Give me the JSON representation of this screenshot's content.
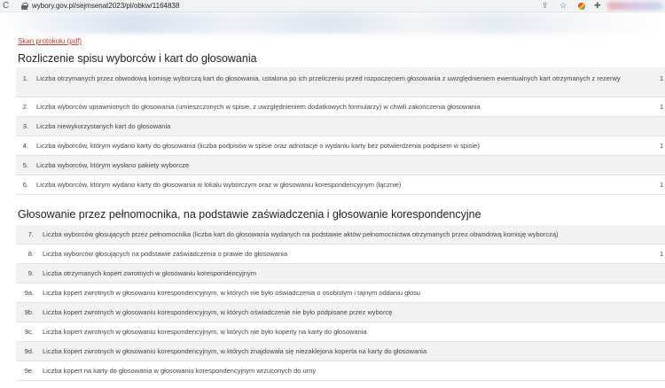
{
  "browser": {
    "reload_icon": "reload-icon",
    "lock_icon": "lock-icon",
    "url": "wybory.gov.pl/sejmsenat2023/pl/obkw/1164838"
  },
  "links": {
    "protocol_scan": "Skan protokołu (pdf)"
  },
  "section1": {
    "title": "Rozliczenie spisu wyborców i kart do głosowania",
    "rows": [
      {
        "num": "1.",
        "label": "Liczba otrzymanych przez obwodową komisję wyborczą kart do głosowania, ustalona po ich przeliczeniu przed rozpoczęciem głosowania z uwzględnieniem ewentualnych kart otrzymanych z rezerwy",
        "value": "1 (",
        "shaded": true
      },
      {
        "num": "2.",
        "label": "Liczba wyborców uprawnionych do głosowania (umieszczonych w spisie, z uwzględnieniem dodatkowych formularzy) w chwili zakończenia głosowania",
        "value": "1 :",
        "shaded": false
      },
      {
        "num": "3.",
        "label": "Liczba niewykorzystanych kart do głosowania",
        "value": "",
        "shaded": true
      },
      {
        "num": "4.",
        "label": "Liczba wyborców, którym wydano karty do głosowania (liczba podpisów w spisie oraz adnotacje o wydaniu karty bez potwierdzenia podpisem w spisie)",
        "value": "1 4",
        "shaded": false
      },
      {
        "num": "5.",
        "label": "Liczba wyborców, którym wysłano pakiety wyborcze",
        "value": "",
        "shaded": true
      },
      {
        "num": "6.",
        "label": "Liczba wyborców, którym wydano karty do głosowania w lokalu wyborczym oraz w głosowaniu korespondencyjnym (łącznie)",
        "value": "1 4",
        "shaded": false
      }
    ]
  },
  "section2": {
    "title": "Głosowanie przez pełnomocnika, na podstawie zaświadczenia i głosowanie korespondencyjne",
    "rows": [
      {
        "num": "7.",
        "label": "Liczba wyborców głosujących przez pełnomocnika (liczba kart do głosowania wydanych na podstawie aktów pełnomocnictwa otrzymanych przez obwodową komisję wyborczą)",
        "value": "",
        "shaded": true
      },
      {
        "num": "8.",
        "label": "Liczba wyborców głosujących na podstawie zaświadczenia o prawie do głosowania",
        "value": "1 4",
        "shaded": false
      },
      {
        "num": "9.",
        "label": "Liczba otrzymanych kopert zwrotnych w głosowaniu korespondencyjnym",
        "value": "",
        "shaded": true
      },
      {
        "num": "9a.",
        "label": "Liczba kopert zwrotnych w głosowaniu korespondencyjnym, w których nie było oświadczenia o osobistym i tajnym oddaniu głosu",
        "value": "",
        "shaded": false
      },
      {
        "num": "9b.",
        "label": "Liczba kopert zwrotnych w głosowaniu korespondencyjnym, w których oświadczenie nie było podpisane przez wyborcę",
        "value": "",
        "shaded": true
      },
      {
        "num": "9c.",
        "label": "Liczba kopert zwrotnych w głosowaniu korespondencyjnym, w których nie było koperty na karty do głosowania",
        "value": "",
        "shaded": false
      },
      {
        "num": "9d.",
        "label": "Liczba kopert zwrotnych w głosowaniu korespondencyjnym, w których znajdowała się niezaklejona koperta na karty do głosowania",
        "value": "",
        "shaded": true
      },
      {
        "num": "9e.",
        "label": "Liczba kopert na karty do głosowania w głosowaniu korespondencyjnym wrzuconych do urny",
        "value": "",
        "shaded": false
      }
    ]
  }
}
